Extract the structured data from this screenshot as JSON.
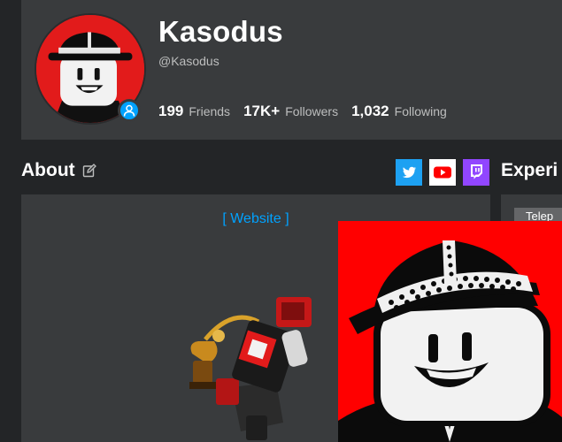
{
  "profile": {
    "display_name": "Kasodus",
    "username": "@Kasodus",
    "stats": [
      {
        "value": "199",
        "label": "Friends"
      },
      {
        "value": "17K+",
        "label": "Followers"
      },
      {
        "value": "1,032",
        "label": "Following"
      }
    ]
  },
  "about": {
    "title": "About",
    "website_link": "[ Website ]"
  },
  "social_links": [
    "twitter-icon",
    "youtube-icon",
    "twitch-icon"
  ],
  "experiences": {
    "title": "Experi",
    "tab_label": "Telep"
  },
  "colors": {
    "background": "#232527",
    "card": "#393b3d",
    "link": "#00a2ff",
    "twitter": "#1da1f2",
    "youtube": "#ff0000",
    "twitch": "#9146ff",
    "avatar_bg": "#ff0000"
  }
}
